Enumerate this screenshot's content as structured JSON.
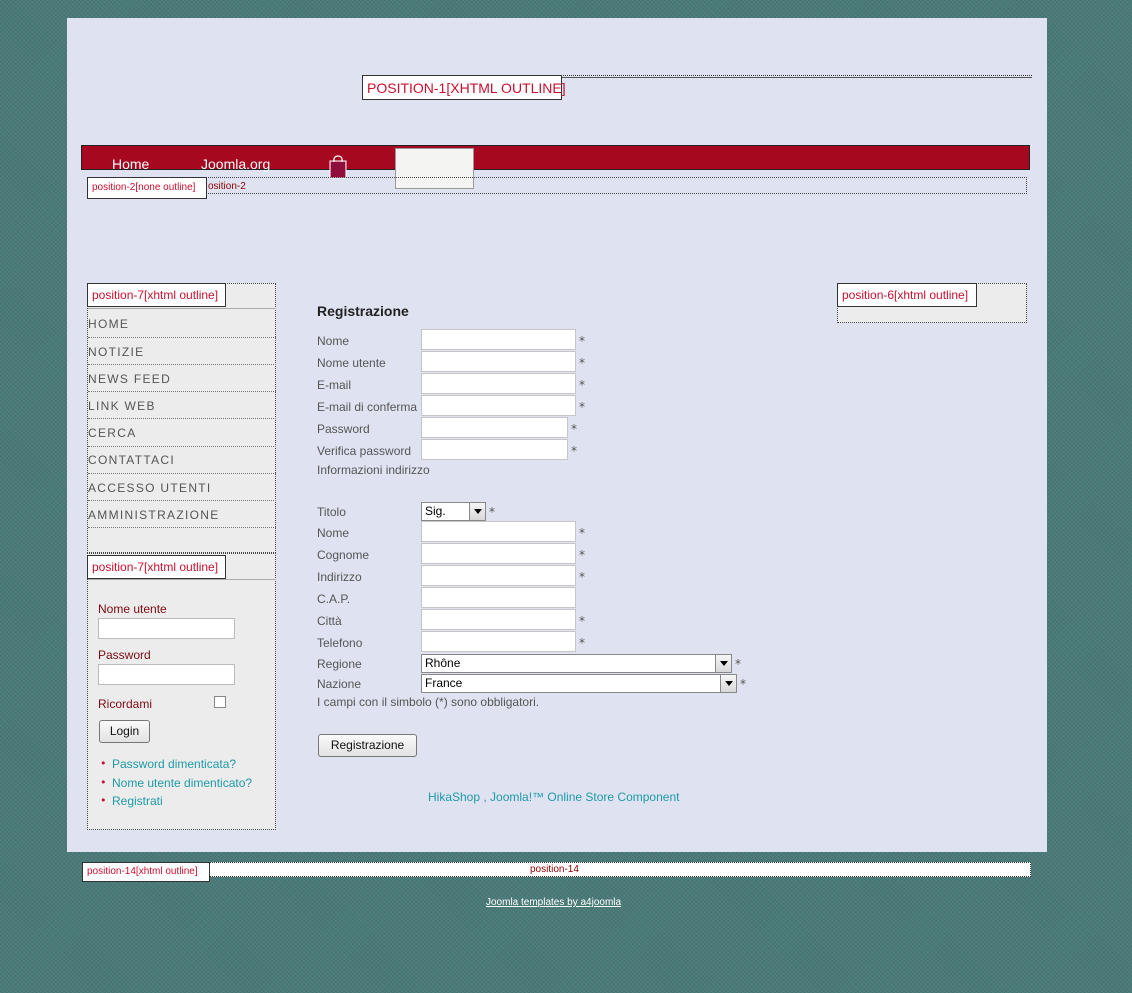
{
  "top": {
    "position1_label": "POSITION-1[XHTML OUTLINE]"
  },
  "nav": {
    "items": [
      "Home",
      "Joomla.org"
    ]
  },
  "position2": {
    "label": "position-2[none outline]",
    "text": "osition-2"
  },
  "left_menu": {
    "label": "position-7[xhtml outline]",
    "items": [
      "HOME",
      "NOTIZIE",
      "NEWS FEED",
      "LINK WEB",
      "CERCA",
      "CONTATTACI",
      "ACCESSO UTENTI",
      "AMMINISTRAZIONE"
    ]
  },
  "login": {
    "label": "position-7[xhtml outline]",
    "username_label": "Nome utente",
    "password_label": "Password",
    "remember_label": "Ricordami",
    "login_button": "Login",
    "links": [
      "Password dimenticata?",
      "Nome utente dimenticato?",
      "Registrati"
    ]
  },
  "right": {
    "label": "position-6[xhtml outline]"
  },
  "registration": {
    "title": "Registrazione",
    "fields": [
      "Nome",
      "Nome utente",
      "E-mail",
      "E-mail di conferma",
      "Password",
      "Verifica password"
    ],
    "address_heading": "Informazioni indirizzo",
    "address_fields": [
      "Titolo",
      "Nome",
      "Cognome",
      "Indirizzo",
      "C.A.P.",
      "Città",
      "Telefono",
      "Regione",
      "Nazione"
    ],
    "title_select_value": "Sig.",
    "region_value": "Rhône",
    "country_value": "France",
    "required_marker": "*",
    "required_note": "I campi con il simbolo (*) sono obbligatori.",
    "submit_button": "Registrazione"
  },
  "credit": "HikaShop , Joomla!™ Online Store Component",
  "footer": {
    "position14_label": "position-14[xhtml outline]",
    "position14_text": "position-14",
    "link": "Joomla templates by a4joomla"
  },
  "colors": {
    "nav_bg": "#a5081f",
    "label_red": "#c8102e",
    "link_teal": "#1f9aa8",
    "page_bg": "#dfe3f1"
  },
  "icons": [
    "shopping-bag-icon",
    "chevron-down-icon"
  ]
}
